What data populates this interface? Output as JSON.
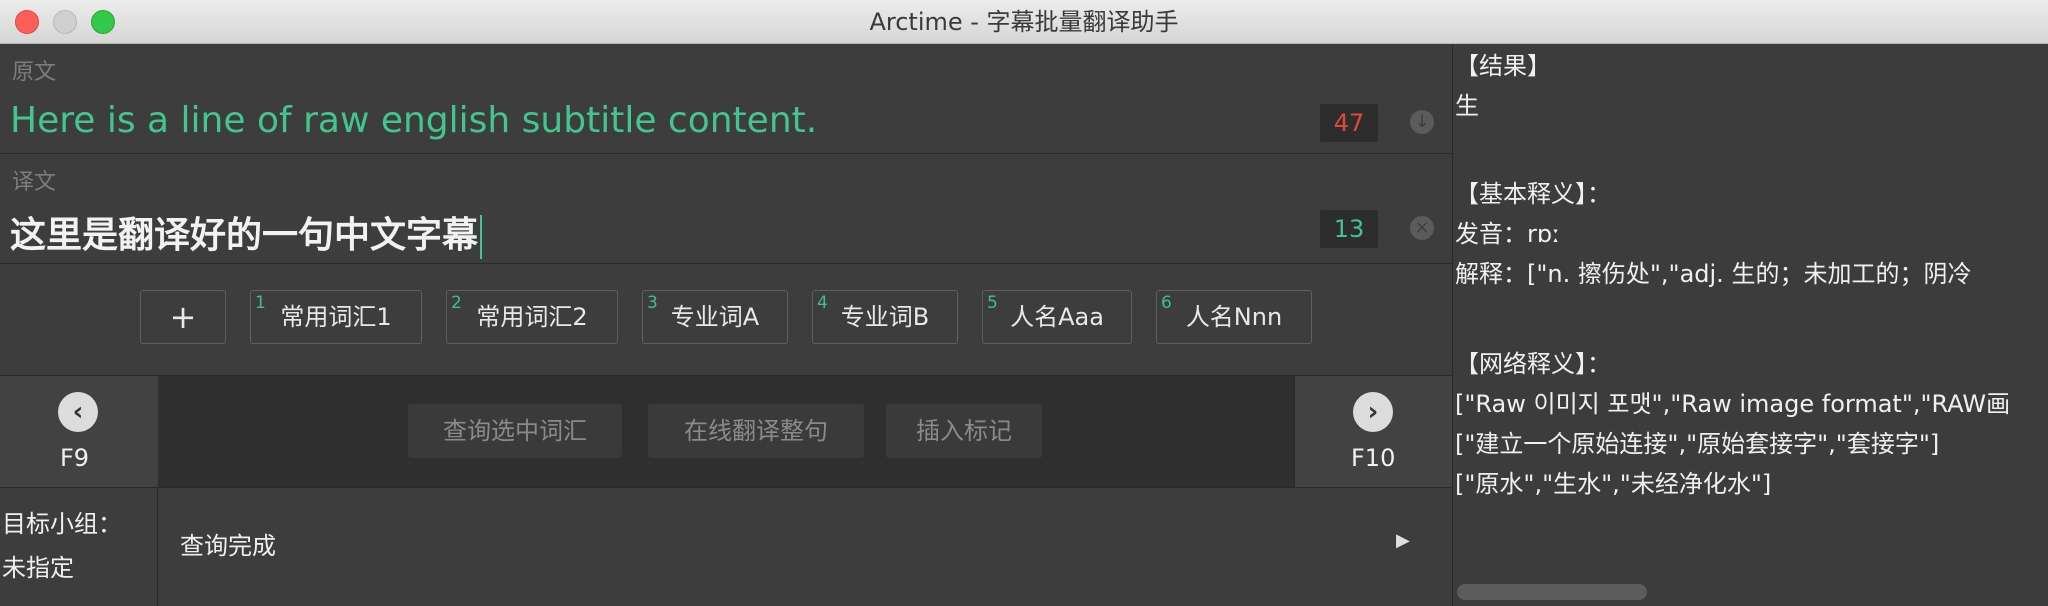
{
  "window": {
    "title": "Arctime - 字幕批量翻译助手"
  },
  "source": {
    "label": "原文",
    "text": "Here is a line of raw english subtitle content.",
    "count": "47"
  },
  "translation": {
    "label": "译文",
    "text": "这里是翻译好的一句中文字幕",
    "count": "13"
  },
  "tags": [
    {
      "num": "1",
      "label": "常用词汇1"
    },
    {
      "num": "2",
      "label": "常用词汇2"
    },
    {
      "num": "3",
      "label": "专业词A"
    },
    {
      "num": "4",
      "label": "专业词B"
    },
    {
      "num": "5",
      "label": "人名Aaa"
    },
    {
      "num": "6",
      "label": "人名Nnn"
    }
  ],
  "add_label": "+",
  "nav": {
    "prev_key": "F9",
    "next_key": "F10",
    "actions": [
      "查询选中词汇",
      "在线翻译整句",
      "插入标记"
    ]
  },
  "group": {
    "label": "目标小组：",
    "value": "未指定"
  },
  "status": "查询完成",
  "result": {
    "lines": [
      "【结果】",
      "生",
      "",
      "【基本释义】：",
      "发音：rɒː",
      "解释：[\"n. 擦伤处\",\"adj. 生的；未加工的；阴冷",
      "",
      "【网络释义】：",
      "[\"Raw 이미지 포맷\",\"Raw image format\",\"RAW画",
      "[\"建立一个原始连接\",\"原始套接字\",\"套接字\"]",
      "[\"原水\",\"生水\",\"未经净化水\"]"
    ]
  },
  "icons": {
    "prev": "chevron-left-icon",
    "next": "chevron-right-icon",
    "download": "arrow-down-icon",
    "clear": "close-icon",
    "play": "play-icon"
  }
}
